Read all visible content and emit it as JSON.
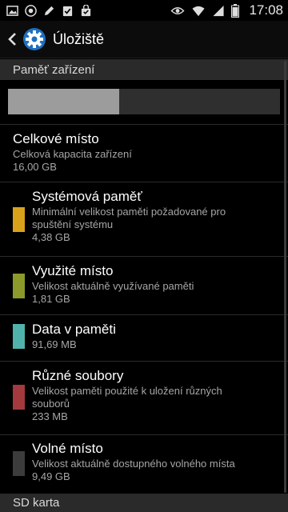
{
  "statusbar": {
    "left_icons": [
      "gallery-icon",
      "chrome-icon",
      "pen-icon",
      "clipboard-check-icon",
      "shopping-bag-icon"
    ],
    "right_icons": [
      "eye-icon",
      "wifi-icon",
      "signal-icon",
      "battery-icon"
    ],
    "time": "17:08"
  },
  "actionbar": {
    "title": "Úložiště",
    "icon": "gear-icon"
  },
  "device_section": {
    "header": "Paměť zařízení",
    "usage_fraction": 0.41,
    "total": {
      "title": "Celkové místo",
      "subtitle": "Celková kapacita zařízení",
      "value": "16,00 GB"
    },
    "items": [
      {
        "title": "Systémová paměť",
        "line1": "Minimální velikost paměti požadované pro",
        "line2": "spuštění systému",
        "value": "4,38 GB",
        "color": "#d9a21b"
      },
      {
        "title": "Využité místo",
        "line1": "Velikost aktuálně využívané paměti",
        "line2": "",
        "value": "1,81 GB",
        "color": "#8b9a2a"
      },
      {
        "title": "Data v paměti",
        "line1": "",
        "line2": "",
        "value": "91,69 MB",
        "color": "#4fb3ac"
      },
      {
        "title": "Různé soubory",
        "line1": "Velikost paměti použité k uložení různých",
        "line2": "souborů",
        "value": "233 MB",
        "color": "#a43a3e"
      },
      {
        "title": "Volné místo",
        "line1": "Velikost aktuálně dostupného volného místa",
        "line2": "",
        "value": "9,49 GB",
        "color": "#3c3c3c"
      }
    ]
  },
  "sd_section": {
    "header": "SD karta"
  }
}
